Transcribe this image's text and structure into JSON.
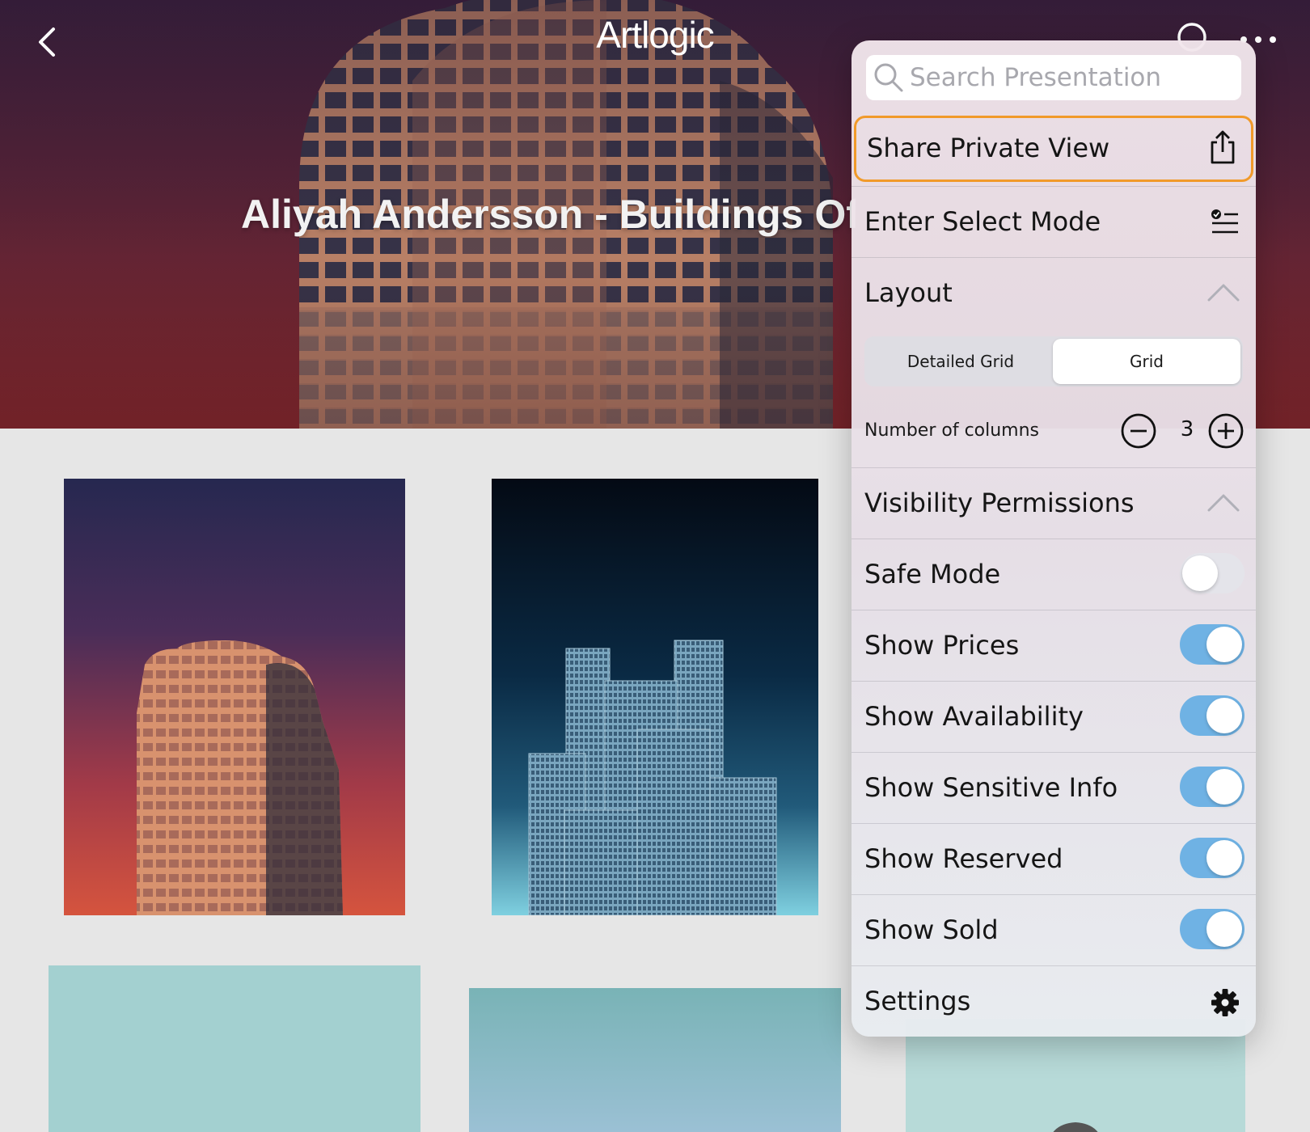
{
  "header": {
    "logo": "Artlogic",
    "title": "Aliyah Andersson - Buildings Of",
    "back_icon": "chevron-left-icon",
    "search_icon": "search-icon",
    "more_icon": "more-icon"
  },
  "menu": {
    "search_placeholder": "Search Presentation",
    "share_label": "Share Private View",
    "select_mode_label": "Enter Select Mode",
    "layout": {
      "label": "Layout",
      "options": [
        "Detailed Grid",
        "Grid"
      ],
      "selected": "Grid",
      "columns_label": "Number of columns",
      "columns_value": "3"
    },
    "visibility": {
      "label": "Visibility Permissions",
      "toggles": [
        {
          "label": "Safe Mode",
          "on": false
        },
        {
          "label": "Show Prices",
          "on": true
        },
        {
          "label": "Show Availability",
          "on": true
        },
        {
          "label": "Show Sensitive Info",
          "on": true
        },
        {
          "label": "Show Reserved",
          "on": true
        },
        {
          "label": "Show Sold",
          "on": true
        }
      ]
    },
    "settings_label": "Settings"
  },
  "colors": {
    "accent_outline": "#f19a2a",
    "toggle_on": "#6fb2e4",
    "toggle_off": "#e4e4ea"
  }
}
